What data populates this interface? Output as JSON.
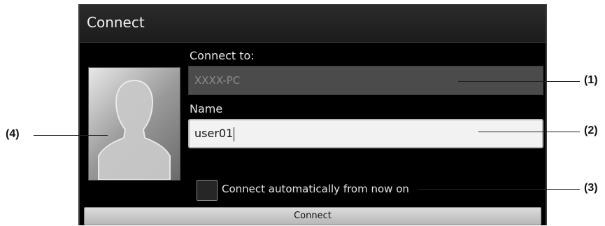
{
  "dialog": {
    "title": "Connect",
    "connect_to_label": "Connect to:",
    "host_placeholder": "XXXX-PC",
    "name_label": "Name",
    "name_value": "user01",
    "auto_connect_label": "Connect automatically from now on",
    "auto_connect_checked": false,
    "connect_button": "Connect",
    "avatar_icon": "user-silhouette-icon"
  },
  "callouts": {
    "c1": "(1)",
    "c2": "(2)",
    "c3": "(3)",
    "c4": "(4)"
  },
  "colors": {
    "dialog_bg": "#000000",
    "title_bar": "#1f1f1f",
    "host_field_bg": "#4b4b4b",
    "name_field_bg": "#f2f2f2",
    "button_bg": "#c9c9c9"
  }
}
